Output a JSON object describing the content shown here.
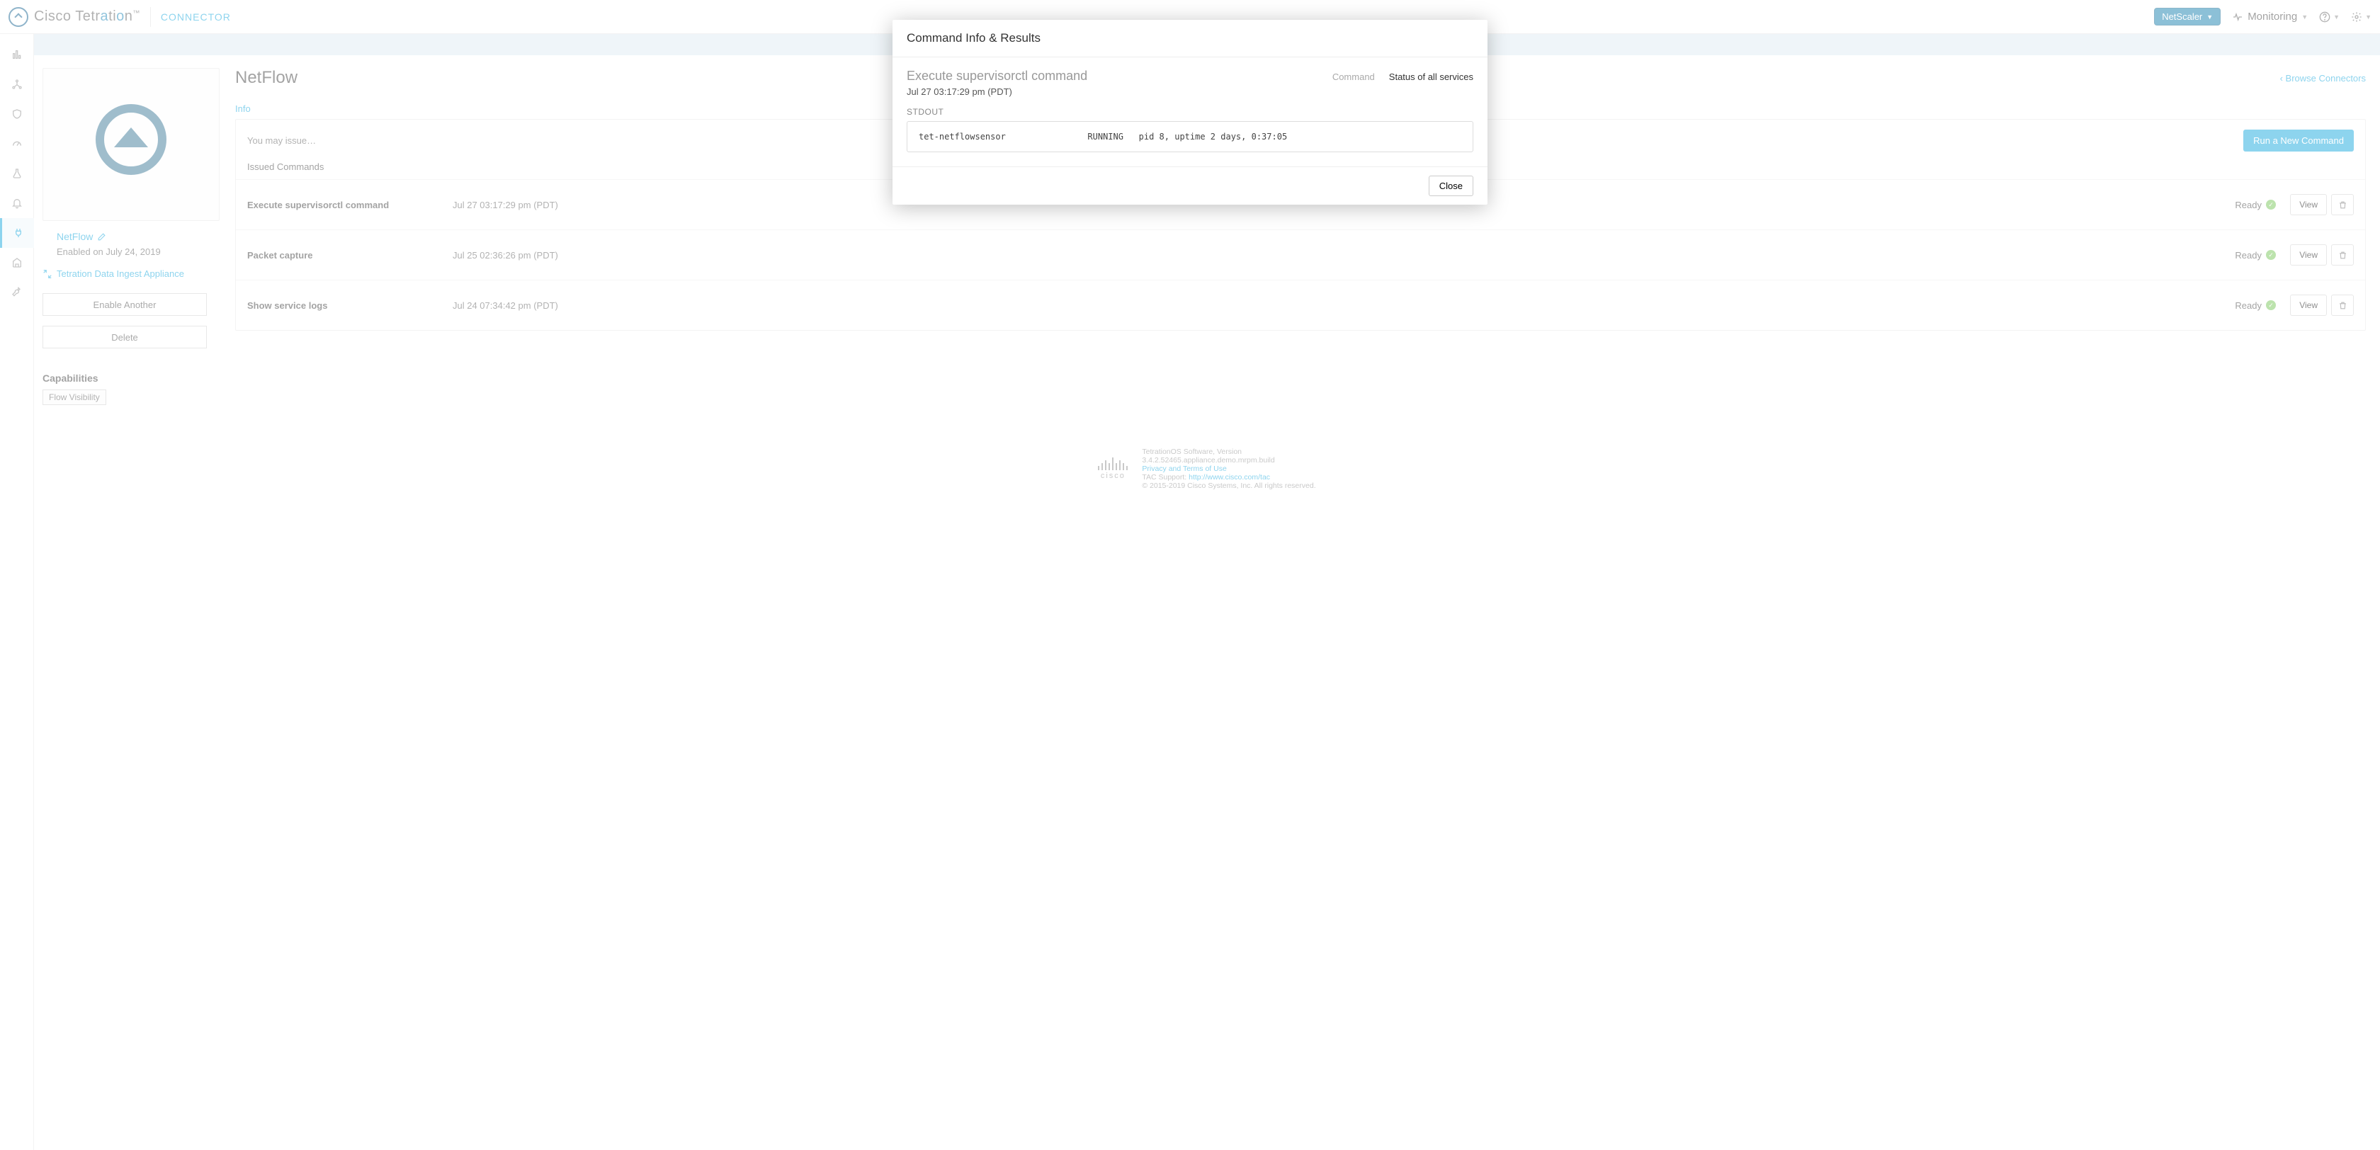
{
  "topbar": {
    "brand": "Cisco Tetration",
    "connector": "CONNECTOR",
    "scope": "NetScaler",
    "monitoring": "Monitoring"
  },
  "sidecard": {
    "name": "NetFlow",
    "enabled": "Enabled on July 24, 2019",
    "ingest_link": "Tetration Data Ingest Appliance",
    "enable_another": "Enable Another",
    "delete": "Delete",
    "caps_head": "Capabilities",
    "cap1": "Flow Visibility"
  },
  "main": {
    "title": "NetFlow",
    "browse": "Browse Connectors",
    "tabs": {
      "info": "Info"
    },
    "note": "You may issue…",
    "run_btn": "Run a New Command",
    "issued": "Issued Commands",
    "view": "View",
    "rows": [
      {
        "name": "Execute supervisorctl command",
        "time": "Jul 27 03:17:29 pm (PDT)",
        "status": "Ready"
      },
      {
        "name": "Packet capture",
        "time": "Jul 25 02:36:26 pm (PDT)",
        "status": "Ready"
      },
      {
        "name": "Show service logs",
        "time": "Jul 24 07:34:42 pm (PDT)",
        "status": "Ready"
      }
    ]
  },
  "modal": {
    "title": "Command Info & Results",
    "subtitle": "Execute supervisorctl command",
    "timestamp": "Jul 27 03:17:29 pm (PDT)",
    "cmd_label": "Command",
    "cmd_value": "Status of all services",
    "stdout_label": "STDOUT",
    "stdout": "tet-netflowsensor                RUNNING   pid 8, uptime 2 days, 0:37:05",
    "close": "Close"
  },
  "footer": {
    "line1": "TetrationOS Software, Version",
    "line2": "3.4.2.52465.appliance.demo.mrpm.build",
    "privacy": "Privacy and Terms of Use",
    "tac_label": "TAC Support: ",
    "tac_link": "http://www.cisco.com/tac",
    "copyright": "© 2015-2019 Cisco Systems, Inc. All rights reserved.",
    "cisco": "cisco"
  }
}
